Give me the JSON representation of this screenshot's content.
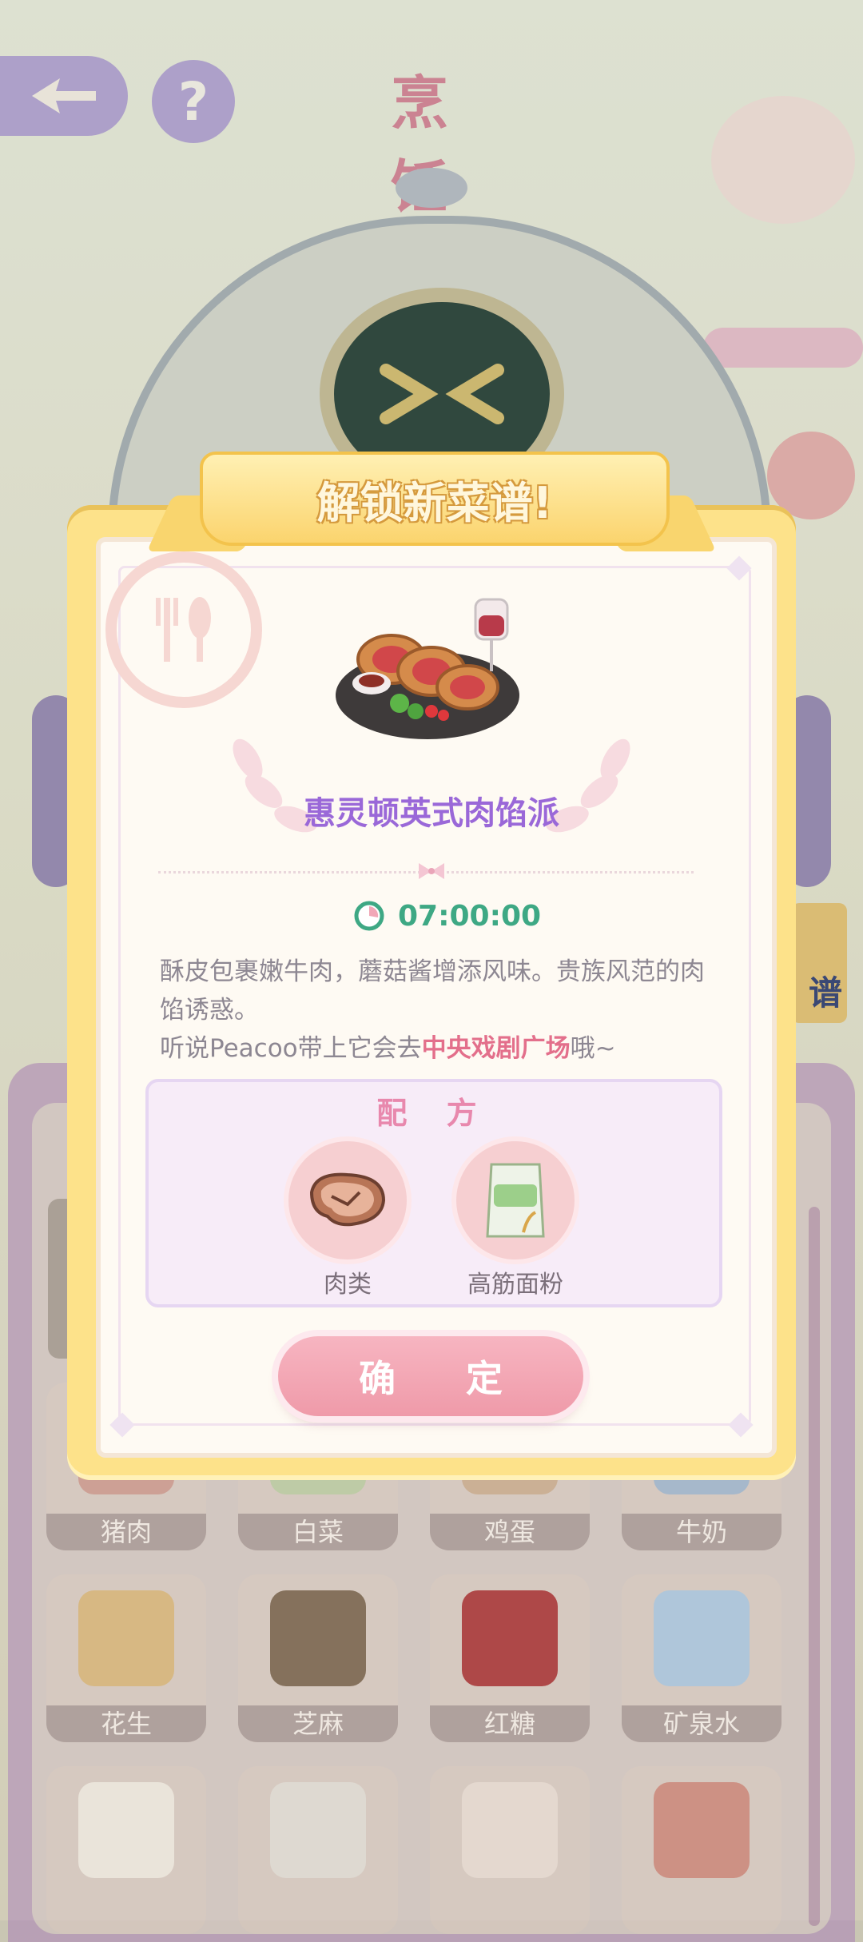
{
  "header": {
    "title": "烹 饪",
    "help_symbol": "?"
  },
  "scene": {
    "robot_face_text": "&gt; &lt;",
    "side_tab_text": "谱"
  },
  "ingredients_grid": [
    {
      "label": "猪肉",
      "icon": "pork-icon"
    },
    {
      "label": "白菜",
      "icon": "cabbage-icon"
    },
    {
      "label": "鸡蛋",
      "icon": "egg-icon"
    },
    {
      "label": "牛奶",
      "icon": "milk-icon"
    },
    {
      "label": "花生",
      "icon": "peanut-bag-icon"
    },
    {
      "label": "芝麻",
      "icon": "sesame-sack-icon"
    },
    {
      "label": "红糖",
      "icon": "brown-sugar-bag-icon"
    },
    {
      "label": "矿泉水",
      "icon": "water-bottle-icon"
    },
    {
      "label": "",
      "icon": "flatbread-stack-icon"
    },
    {
      "label": "",
      "icon": "dough-plate-icon"
    },
    {
      "label": "",
      "icon": "bowl-icon"
    },
    {
      "label": "",
      "icon": "bacon-icon"
    }
  ],
  "popup": {
    "banner": "解锁新菜谱!",
    "dish_name": "惠灵顿英式肉馅派",
    "dish_icon": "beef-wellington-dish-icon",
    "timer": "07:00:00",
    "description_line1": "酥皮包裹嫩牛肉，蘑菇酱增添风味。贵族风范的肉馅诱惑。",
    "description_line2_prefix": "听说Peacoo带上它会去",
    "description_highlight": "中央戏剧广场",
    "description_line2_suffix": "哦~",
    "recipe_title": "配 方",
    "recipe": [
      {
        "name": "肉类",
        "icon": "meat-icon"
      },
      {
        "name": "高筋面粉",
        "icon": "flour-bag-icon"
      }
    ],
    "confirm_label": "确 定"
  },
  "colors": {
    "frame_yellow": "#fde28a",
    "dish_name_purple": "#9a68d8",
    "timer_green": "#3ea884",
    "highlight_pink": "#e36f8b",
    "confirm_pink": "#ef9aa9"
  }
}
